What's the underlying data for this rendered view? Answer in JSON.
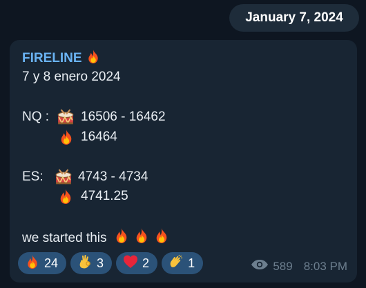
{
  "date_separator": "January 7, 2024",
  "message": {
    "sender": "FIRELINE",
    "date_line": "7 y 8 enero 2024",
    "nq": {
      "label": "NQ :",
      "range": "16506 - 16462",
      "target": "16464"
    },
    "es": {
      "label": "ES:",
      "range": "4743 - 4734",
      "target": "4741.25"
    },
    "closing": "we started this",
    "views": "589",
    "time": "8:03 PM"
  },
  "reactions": [
    {
      "emoji": "fire",
      "count": "24"
    },
    {
      "emoji": "ok-hand",
      "count": "3"
    },
    {
      "emoji": "heart",
      "count": "2"
    },
    {
      "emoji": "clapping-hands",
      "count": "1"
    }
  ],
  "colors": {
    "background": "#0e1621",
    "bubble": "#182533",
    "sender": "#6ab3f3",
    "reaction_chip": "#2b5278",
    "meta": "#6d7f8f"
  }
}
